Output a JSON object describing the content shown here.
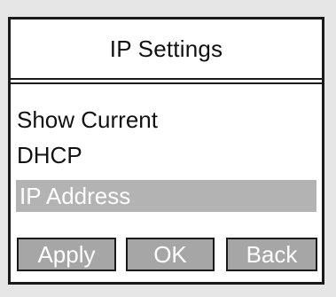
{
  "title": "IP Settings",
  "menu": {
    "items": [
      {
        "label": "Show Current",
        "selected": false
      },
      {
        "label": "DHCP",
        "selected": false
      },
      {
        "label": "IP Address",
        "selected": true
      }
    ]
  },
  "softkeys": {
    "apply": "Apply",
    "ok": "OK",
    "back": "Back"
  },
  "colors": {
    "selection": "#b3b3b3",
    "softkey": "#a6a6a6",
    "border": "#1a1a1a"
  }
}
